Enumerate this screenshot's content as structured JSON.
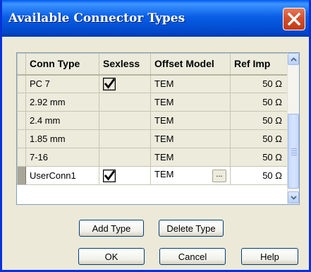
{
  "window": {
    "title": "Available Connector Types",
    "close_icon": "close-icon"
  },
  "grid": {
    "columns": [
      "Conn Type",
      "Sexless",
      "Offset Model",
      "Ref Imp"
    ],
    "rows": [
      {
        "conn_type": "PC 7",
        "sexless": true,
        "offset_model": "TEM",
        "ref_imp": "50 Ω"
      },
      {
        "conn_type": "2.92 mm",
        "sexless": false,
        "offset_model": "TEM",
        "ref_imp": "50 Ω"
      },
      {
        "conn_type": "2.4 mm",
        "sexless": false,
        "offset_model": "TEM",
        "ref_imp": "50 Ω"
      },
      {
        "conn_type": "1.85 mm",
        "sexless": false,
        "offset_model": "TEM",
        "ref_imp": "50 Ω"
      },
      {
        "conn_type": "7-16",
        "sexless": false,
        "offset_model": "TEM",
        "ref_imp": "50 Ω"
      },
      {
        "conn_type": "UserConn1",
        "sexless": true,
        "offset_model": "TEM",
        "ref_imp": "50 Ω",
        "selected": true,
        "ellipsis": "..."
      }
    ]
  },
  "buttons": {
    "add_type": "Add Type",
    "delete_type": "Delete Type",
    "ok": "OK",
    "cancel": "Cancel",
    "help": "Help"
  },
  "colors": {
    "titlebar": "#0a5fe6",
    "close_button": "#d4502d",
    "dialog_bg": "#ece9d8"
  }
}
